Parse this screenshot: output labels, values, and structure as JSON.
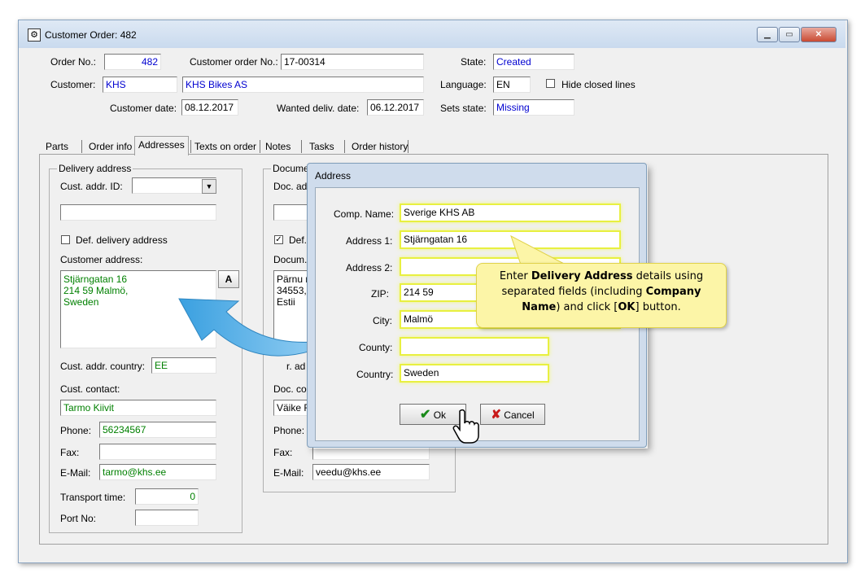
{
  "window": {
    "title": "Customer Order: 482"
  },
  "header": {
    "order_no_label": "Order No.:",
    "order_no": "482",
    "customer_order_no_label": "Customer order No.:",
    "customer_order_no": "17-00314",
    "state_label": "State:",
    "state": "Created",
    "customer_label": "Customer:",
    "customer_code": "KHS",
    "customer_name": "KHS Bikes AS",
    "language_label": "Language:",
    "language": "EN",
    "hide_closed_label": "Hide closed lines",
    "customer_date_label": "Customer date:",
    "customer_date": "08.12.2017",
    "wanted_date_label": "Wanted deliv. date:",
    "wanted_date": "06.12.2017",
    "sets_state_label": "Sets state:",
    "sets_state": "Missing"
  },
  "tabs": [
    "Parts",
    "Order info",
    "Addresses",
    "Texts on order",
    "Notes",
    "Tasks",
    "Order history"
  ],
  "delivery": {
    "group_label": "Delivery address",
    "cust_addr_id_label": "Cust. addr. ID:",
    "def_delivery_label": "Def. delivery address",
    "customer_address_label": "Customer address:",
    "address_lines": [
      "Stjärngatan 16",
      "214 59 Malmö,",
      "Sweden"
    ],
    "a_button": "A",
    "country_label": "Cust. addr. country:",
    "country": "EE",
    "contact_label": "Cust. contact:",
    "contact": "Tarmo Kiivit",
    "phone_label": "Phone:",
    "phone": "56234567",
    "fax_label": "Fax:",
    "fax": "",
    "email_label": "E-Mail:",
    "email": "tarmo@khs.ee",
    "transport_label": "Transport time:",
    "transport": "0",
    "port_label": "Port No:",
    "port": ""
  },
  "document": {
    "group_label": "Docume",
    "doc_addr_label": "Doc. ad",
    "def_label": "Def.",
    "doc_label": "Docum.",
    "address_lines": [
      "Pärnu r",
      "34553,",
      "Estii"
    ],
    "ad_label": "r. ad",
    "contact_label": "Doc. co",
    "contact": "Väike F",
    "phone_label": "Phone:",
    "fax_label": "Fax:",
    "email_label": "E-Mail:",
    "email": "veedu@khs.ee"
  },
  "dialog": {
    "title": "Address",
    "comp_name_label": "Comp. Name:",
    "comp_name": "Sverige KHS AB",
    "address1_label": "Address 1:",
    "address1": "Stjärngatan 16",
    "address2_label": "Address 2:",
    "address2": "",
    "zip_label": "ZIP:",
    "zip": "214 59",
    "city_label": "City:",
    "city": "Malmö",
    "county_label": "County:",
    "county": "",
    "country_label": "Country:",
    "country": "Sweden",
    "ok_label": "Ok",
    "cancel_label": "Cancel"
  },
  "callout": {
    "t1": "Enter ",
    "b1": "Delivery Address",
    "t2": " details using separated fields (including ",
    "b2": "Company Name",
    "t3": ") and click [",
    "b3": "OK",
    "t4": "] button."
  },
  "colors": {
    "accent_blue": "#0000d0",
    "value_green": "#008000",
    "highlight": "#e8f040",
    "callout_bg": "#fcf5a7",
    "arrow": "#3aa0e0"
  }
}
